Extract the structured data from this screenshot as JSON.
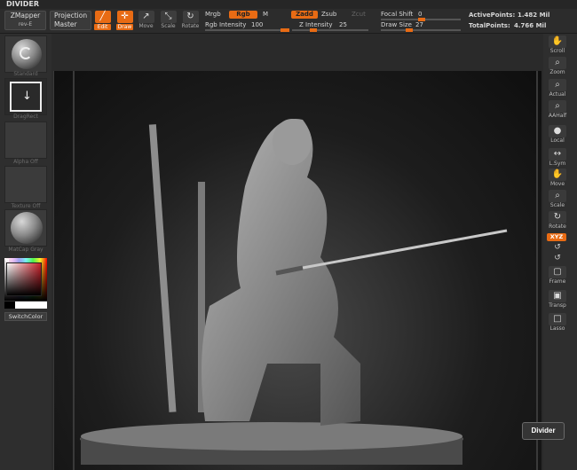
{
  "app": {
    "title": "DIVIDER"
  },
  "topbar": {
    "zmapper": {
      "line1": "ZMapper",
      "line2": "rev-E"
    },
    "projection": {
      "line1": "Projection",
      "line2": "Master"
    },
    "tools": [
      {
        "label": "Edit",
        "icon": "edit-icon"
      },
      {
        "label": "Draw",
        "icon": "draw-icon"
      },
      {
        "label": "Move",
        "icon": "move-icon"
      },
      {
        "label": "Scale",
        "icon": "scale-icon"
      },
      {
        "label": "Rotate",
        "icon": "rotate-icon"
      }
    ],
    "mrgb": "Mrgb",
    "rgb": "Rgb",
    "m": "M",
    "rgb_intensity": {
      "label": "Rgb Intensity",
      "value": "100",
      "level": 1.0
    },
    "zadd": "Zadd",
    "zsub": "Zsub",
    "zcut": "Zcut",
    "z_intensity": {
      "label": "Z Intensity",
      "value": "25",
      "level": 0.25
    },
    "focal_shift": {
      "label": "Focal Shift",
      "value": "0",
      "level": 0.5
    },
    "draw_size": {
      "label": "Draw Size",
      "value": "27",
      "level": 0.05
    },
    "active_points": {
      "label": "ActivePoints:",
      "value": "1.482 Mil"
    },
    "total_points": {
      "label": "TotalPoints:",
      "value": "4.766 Mil"
    }
  },
  "left_panel": {
    "standard": "Standard",
    "dragrect": "DragRect",
    "alpha": "Alpha Off",
    "texture": "Texture Off",
    "matcap": "MatCap Gray",
    "switch_color": "SwitchColor"
  },
  "right_panel": {
    "tools": [
      {
        "label": "Scroll",
        "icon": "hand-icon"
      },
      {
        "label": "Zoom",
        "icon": "zoom-icon"
      },
      {
        "label": "Actual",
        "icon": "actual-icon"
      },
      {
        "label": "AAHalf",
        "icon": "aahalf-icon"
      },
      {
        "label": "Local",
        "icon": "local-icon"
      },
      {
        "label": "L.Sym",
        "icon": "lsym-icon"
      },
      {
        "label": "Move",
        "icon": "move-hand-icon"
      },
      {
        "label": "Scale",
        "icon": "scale-icon"
      },
      {
        "label": "Rotate",
        "icon": "rotate-icon"
      },
      {
        "label": "Frame",
        "icon": "frame-icon"
      },
      {
        "label": "Transp",
        "icon": "transp-icon"
      },
      {
        "label": "Lasso",
        "icon": "lasso-icon"
      }
    ],
    "xyz": "XYZ"
  },
  "tooltip": "Divider",
  "colors": {
    "accent": "#e86b14",
    "bg": "#2a2a2a",
    "viewport": "#1a1a1a"
  }
}
